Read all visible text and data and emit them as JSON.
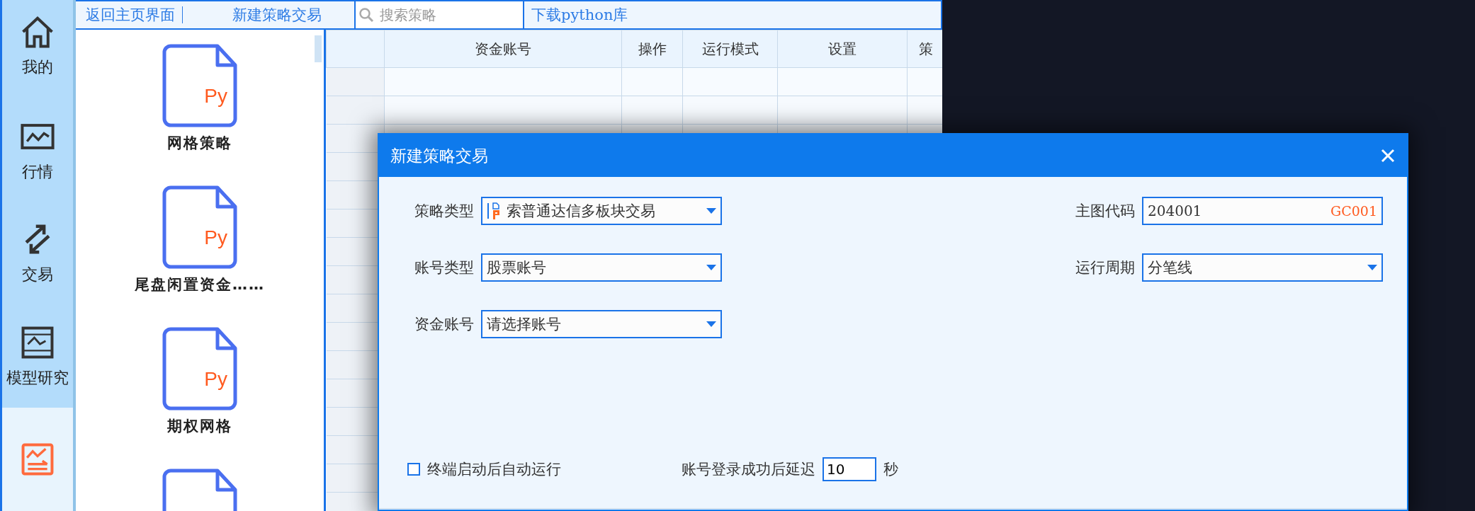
{
  "nav": [
    {
      "label": "我的",
      "selected": false
    },
    {
      "label": "行情",
      "selected": false
    },
    {
      "label": "交易",
      "selected": false
    },
    {
      "label": "模型研究",
      "selected": false
    },
    {
      "selected": true
    }
  ],
  "toolbar": {
    "back": "返回主页界面",
    "new_strategy": "新建策略交易",
    "search_placeholder": "搜索策略",
    "download": "下载python库"
  },
  "strategies": [
    {
      "kind": "file",
      "icon_text": "Py",
      "name": "网格策略"
    },
    {
      "kind": "file",
      "icon_text": "Py",
      "name": "尾盘闲置资金……"
    },
    {
      "kind": "file",
      "icon_text": "Py",
      "name": "期权网格"
    },
    {
      "kind": "file"
    }
  ],
  "table": {
    "columns": [
      "资金账号",
      "操作",
      "运行模式",
      "设置",
      "策"
    ]
  },
  "dialog": {
    "title": "新建策略交易",
    "left_fields": [
      {
        "kind": "combo",
        "label": "策略类型",
        "value": "索普通达信多板块交易",
        "strategy_icon": true
      },
      {
        "kind": "combo",
        "label": "账号类型",
        "value": "股票账号"
      },
      {
        "kind": "combo",
        "label": "资金账号",
        "value": "请选择账号"
      }
    ],
    "right_fields": [
      {
        "kind": "code",
        "label": "主图代码",
        "value": "204001",
        "tag": "GC001"
      },
      {
        "kind": "combo",
        "label": "运行周期",
        "value": "分笔线"
      }
    ],
    "auto_run": {
      "label": "终端启动后自动运行",
      "checked": false
    },
    "delay": {
      "label": "账号登录成功后延迟",
      "value": "10",
      "unit": "秒"
    }
  }
}
